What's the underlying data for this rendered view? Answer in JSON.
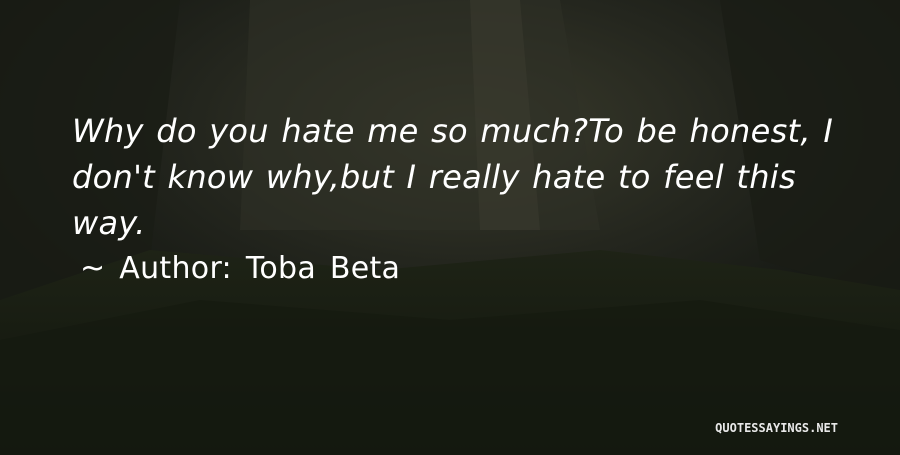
{
  "quote": {
    "text": "Why do you hate me so much?To be honest, I don't know why,but I really hate to feel this way."
  },
  "author": {
    "prefix": "~",
    "label": "Author:",
    "name": "Toba Beta"
  },
  "watermark": {
    "text": "QUOTESSAYINGS.NET"
  },
  "colors": {
    "text": "#ffffff",
    "background": "#141712"
  }
}
